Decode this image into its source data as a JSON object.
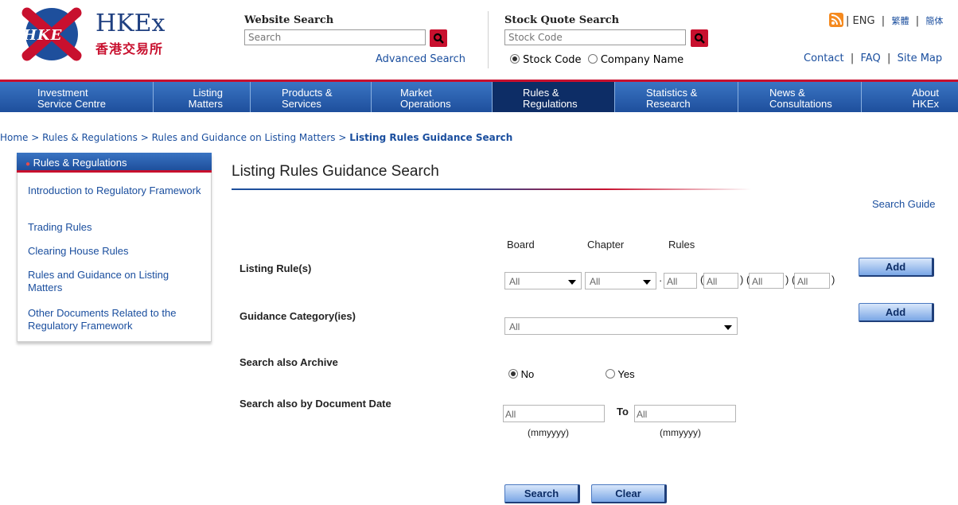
{
  "header": {
    "logo_mark": "HKE",
    "logo_name": "HKEx",
    "logo_chinese": "香港交易所",
    "website_search": {
      "title": "Website Search",
      "placeholder": "Search",
      "advanced_label": "Advanced Search"
    },
    "stock_quote": {
      "title": "Stock Quote Search",
      "placeholder": "Stock Code",
      "options": [
        "Stock Code",
        "Company Name"
      ],
      "selected": "Stock Code"
    },
    "languages": [
      "ENG",
      "繁體",
      "簡体"
    ],
    "links": [
      "Contact",
      "FAQ",
      "Site Map"
    ],
    "accent_color": "#c8102e"
  },
  "nav": {
    "items": [
      {
        "line1": "Investment",
        "line2": "Service Centre"
      },
      {
        "line1": "Listing",
        "line2": "Matters"
      },
      {
        "line1": "Products &",
        "line2": "Services"
      },
      {
        "line1": "Market",
        "line2": "Operations"
      },
      {
        "line1": "Rules &",
        "line2": "Regulations"
      },
      {
        "line1": "Statistics &",
        "line2": "Research"
      },
      {
        "line1": "News &",
        "line2": "Consultations"
      },
      {
        "line1": "About",
        "line2": "HKEx"
      }
    ],
    "active_index": 4,
    "bar_color": "#1e4f9c"
  },
  "breadcrumb": {
    "items": [
      "Home",
      "Rules & Regulations",
      "Rules and Guidance on Listing Matters"
    ],
    "separator": ">",
    "current": "Listing Rules Guidance Search"
  },
  "sidebar": {
    "heading": "Rules & Regulations",
    "items": [
      "Introduction to Regulatory Framework",
      "Trading Rules",
      "Clearing House Rules",
      "Rules and Guidance on Listing Matters",
      "Other Documents Related to the Regulatory Framework"
    ]
  },
  "main": {
    "title": "Listing Rules Guidance Search",
    "search_guide": "Search Guide",
    "columns": {
      "board": "Board",
      "chapter": "Chapter",
      "rules": "Rules"
    },
    "listing_rules": {
      "label": "Listing Rule(s)",
      "board_value": "All",
      "chapter_value": "All",
      "rule_value": "All",
      "sub_values": [
        "All",
        "All",
        "All"
      ],
      "add_label": "Add"
    },
    "guidance": {
      "label": "Guidance Category(ies)",
      "value": "All",
      "add_label": "Add"
    },
    "archive": {
      "label": "Search also Archive",
      "options": [
        "No",
        "Yes"
      ],
      "selected": "No"
    },
    "doc_date": {
      "label": "Search also by Document Date",
      "from_value": "All",
      "to_label": "To",
      "to_value": "All",
      "format_hint": "(mmyyyy)"
    },
    "search_label": "Search",
    "clear_label": "Clear"
  }
}
